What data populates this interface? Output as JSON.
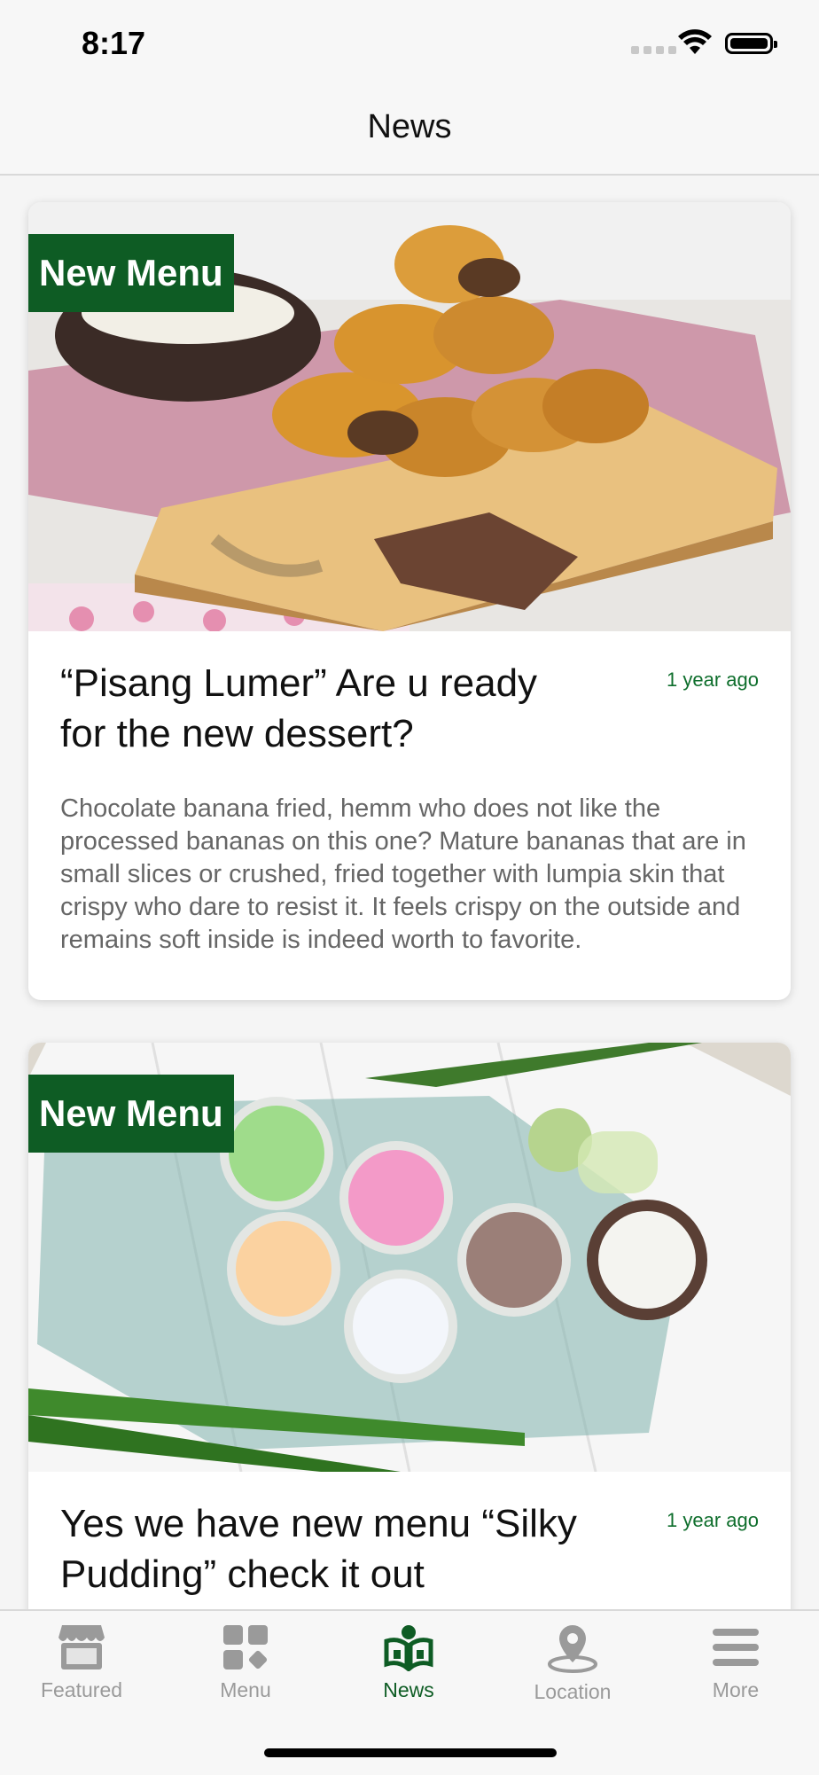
{
  "status_bar": {
    "time": "8:17"
  },
  "navbar": {
    "title": "News"
  },
  "posts": [
    {
      "badge": "New Menu",
      "title": "“Pisang Lumer” Are u ready for the new dessert?",
      "time": "1 year ago",
      "description": "Chocolate banana fried, hemm who does not like the processed bananas on this one? Mature bananas that are in small slices or crushed, fried together with lumpia skin that crispy who dare to resist it. It feels crispy on the outside and remains soft inside is indeed worth to favorite."
    },
    {
      "badge": "New Menu",
      "title": "Yes we have new menu “Silky Pudding” check it out",
      "time": "1 year ago"
    }
  ],
  "tabs": [
    {
      "label": "Featured",
      "icon": "storefront-icon"
    },
    {
      "label": "Menu",
      "icon": "grid-icon"
    },
    {
      "label": "News",
      "icon": "open-book-icon",
      "active": true
    },
    {
      "label": "Location",
      "icon": "map-pin-icon"
    },
    {
      "label": "More",
      "icon": "hamburger-icon"
    }
  ],
  "colors": {
    "brand_green": "#0e5c24",
    "inactive_tab": "#9a9a9a"
  }
}
